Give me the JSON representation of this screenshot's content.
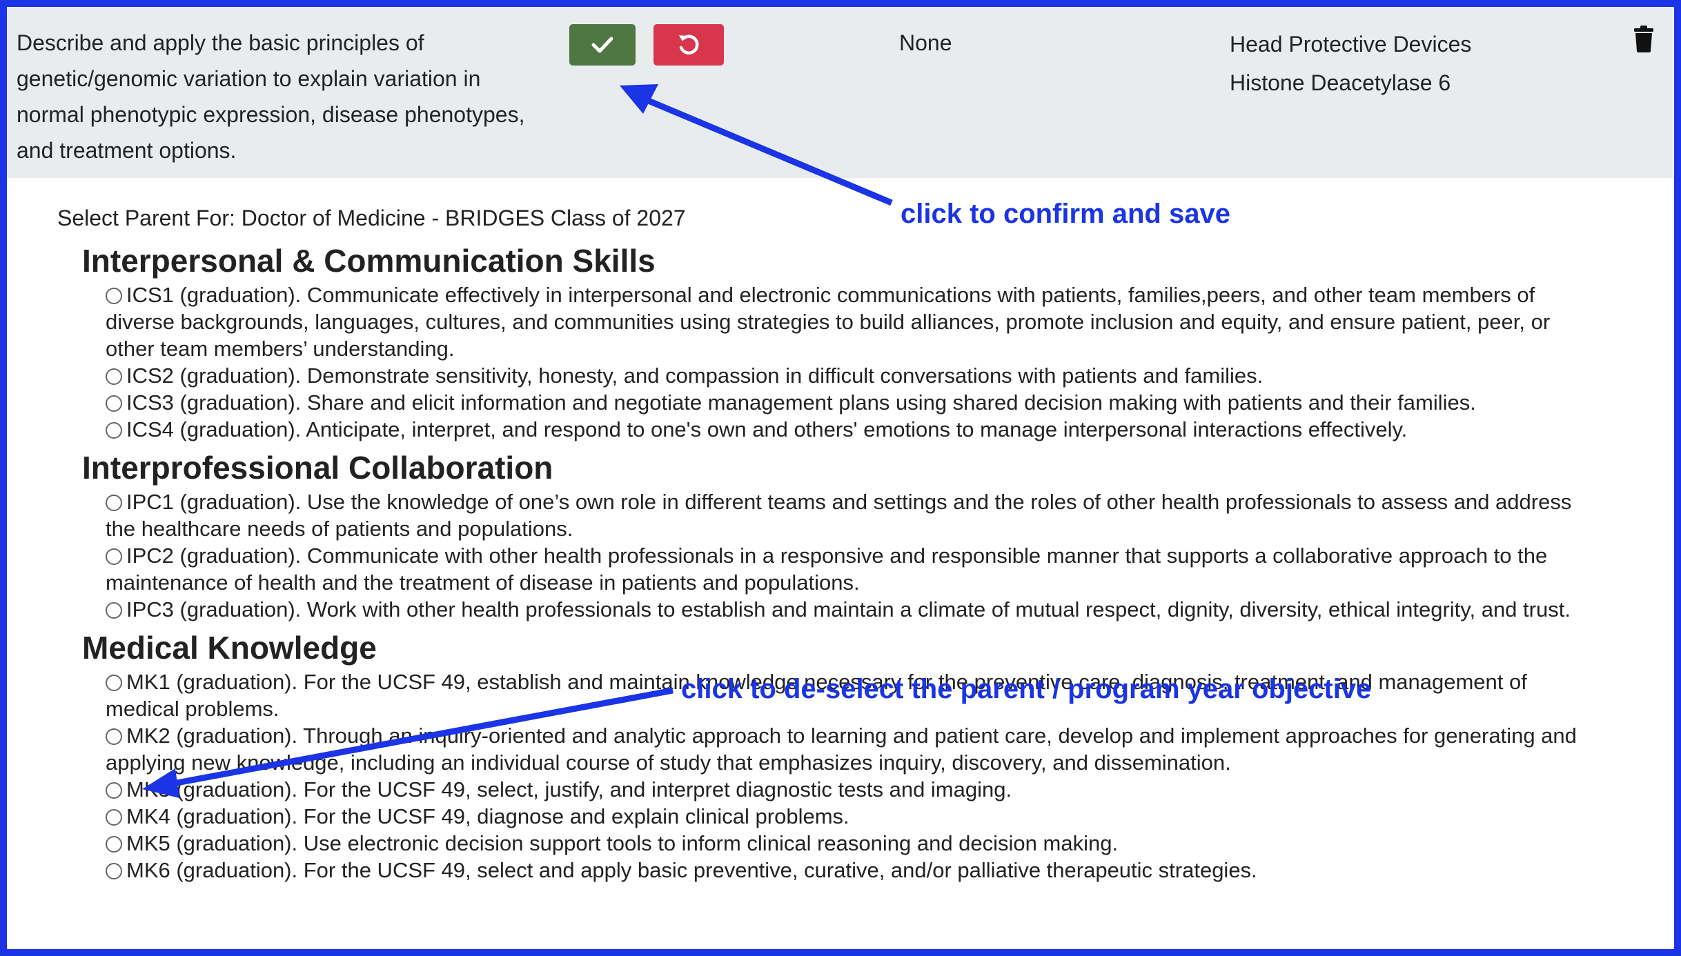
{
  "row": {
    "objective_text": "Describe and apply the basic principles of genetic/genomic variation to explain variation in normal phenotypic expression, disease phenotypes, and treatment options.",
    "confirm_icon": "check-icon",
    "revert_icon": "undo-icon",
    "status": "None",
    "terms": [
      "Head Protective Devices",
      "Histone Deacetylase 6"
    ],
    "delete_icon": "trash-icon"
  },
  "select_parent_label": "Select Parent For: Doctor of Medicine - BRIDGES Class of 2027",
  "groups": [
    {
      "title": "Interpersonal & Communication Skills",
      "objectives": [
        "ICS1 (graduation). Communicate effectively in interpersonal and electronic communications with patients, families,peers, and other team members of diverse backgrounds, languages, cultures, and communities using strategies to build alliances, promote inclusion and equity, and ensure patient, peer, or other team members’ understanding.",
        "ICS2 (graduation). Demonstrate sensitivity, honesty, and compassion in difficult conversations with patients and families.",
        "ICS3 (graduation). Share and elicit information and negotiate management plans using shared decision making with patients and their families.",
        "ICS4 (graduation). Anticipate, interpret, and respond to one's own and others' emotions to manage interpersonal interactions effectively."
      ]
    },
    {
      "title": "Interprofessional Collaboration",
      "objectives": [
        "IPC1 (graduation). Use the knowledge of one’s own role in different teams and settings and the roles of other health professionals to assess and address the healthcare needs of patients and populations.",
        "IPC2 (graduation). Communicate with other health professionals in a responsive and responsible manner that supports a collaborative approach to the maintenance of health and the treatment of disease in patients and populations.",
        "IPC3 (graduation). Work with other health professionals to establish and maintain a climate of mutual respect, dignity, diversity, ethical integrity, and trust."
      ]
    },
    {
      "title": "Medical Knowledge",
      "objectives": [
        "MK1 (graduation). For the UCSF 49, establish and maintain knowledge necessary for the preventive care, diagnosis, treatment, and management of medical problems.",
        "MK2 (graduation). Through an inquiry-oriented and analytic approach to learning and patient care, develop and implement approaches for generating and applying new knowledge, including an individual course of study that emphasizes inquiry, discovery, and dissemination.",
        "MK3 (graduation). For the UCSF 49, select, justify, and interpret diagnostic tests and imaging.",
        "MK4 (graduation). For the UCSF 49, diagnose and explain clinical problems.",
        "MK5 (graduation). Use electronic decision support tools to inform clinical reasoning and decision making.",
        "MK6 (graduation). For the UCSF 49, select and apply basic preventive, curative, and/or palliative therapeutic strategies."
      ]
    }
  ],
  "annotations": {
    "confirm": "click to confirm and save",
    "deselect": "click to de-select the parent / program year objective",
    "color": "#1a34e6"
  },
  "colors": {
    "frame": "#1a34e6",
    "row_background": "#e9ecef",
    "confirm_button": "#4e7741",
    "revert_button": "#d7364d"
  }
}
